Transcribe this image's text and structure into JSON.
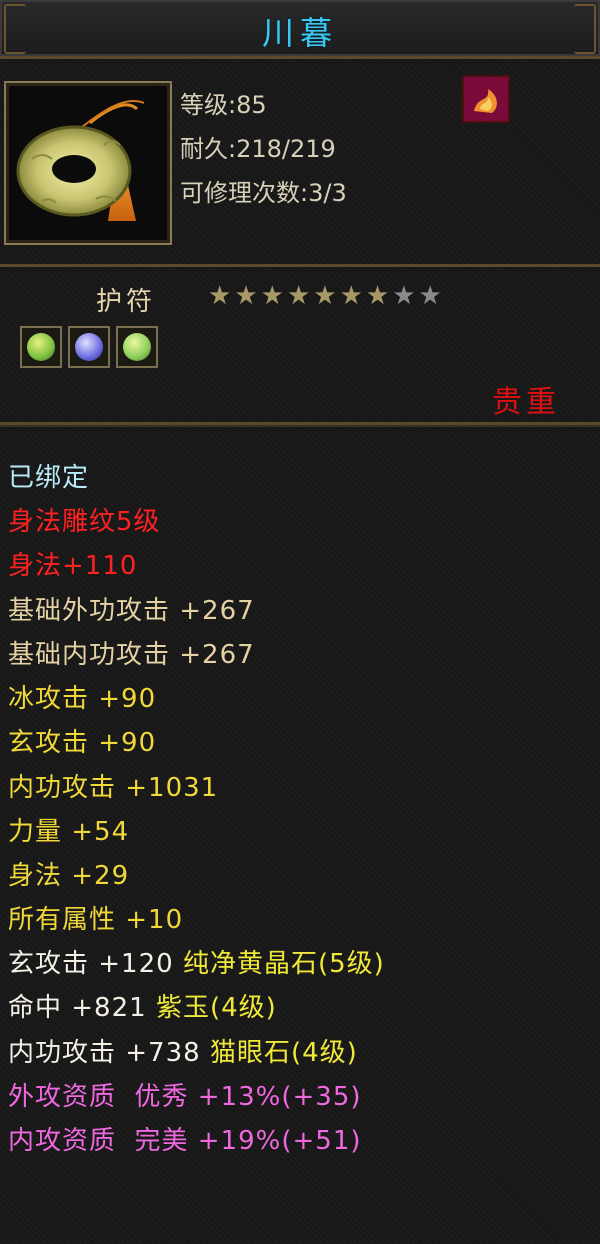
{
  "item": {
    "name": "川暮",
    "level_text": "等级:85",
    "durability_text": "耐久:218/219",
    "repair_text": "可修理次数:3/3"
  },
  "category": {
    "type": "护符",
    "stars_total": 9,
    "stars_filled": 7,
    "quality": "贵重",
    "gems": [
      {
        "name": "green-gem-icon",
        "color": "#7ac040"
      },
      {
        "name": "blue-gem-icon",
        "color": "#6a6ae0"
      },
      {
        "name": "green-gem-icon",
        "color": "#8acc58"
      }
    ]
  },
  "stats": {
    "bound": "已绑定",
    "engraving": "身法雕纹5级",
    "engraving_bonus": "身法+110",
    "base_ext_attack": "基础外功攻击 +267",
    "base_int_attack": "基础内功攻击 +267",
    "ice_attack": "冰攻击 +90",
    "mystic_attack": "玄攻击 +90",
    "internal_attack": "内功攻击 +1031",
    "strength": "力量 +54",
    "agility": "身法 +29",
    "all_attributes": "所有属性 +10",
    "gem1_stat": "玄攻击 +120",
    "gem1_name": "纯净黄晶石(5级)",
    "gem2_stat": "命中 +821",
    "gem2_name": "紫玉(4级)",
    "gem3_stat": "内功攻击 +738",
    "gem3_name": "猫眼石(4级)",
    "ext_quality": "外攻资质  优秀 +13%(+35)",
    "int_quality": "内攻资质  完美 +19%(+51)"
  },
  "colors": {
    "title": "#38c8f0",
    "quality_red": "#e01010",
    "star_filled": "#a89868",
    "star_empty": "#8a8a8a"
  }
}
